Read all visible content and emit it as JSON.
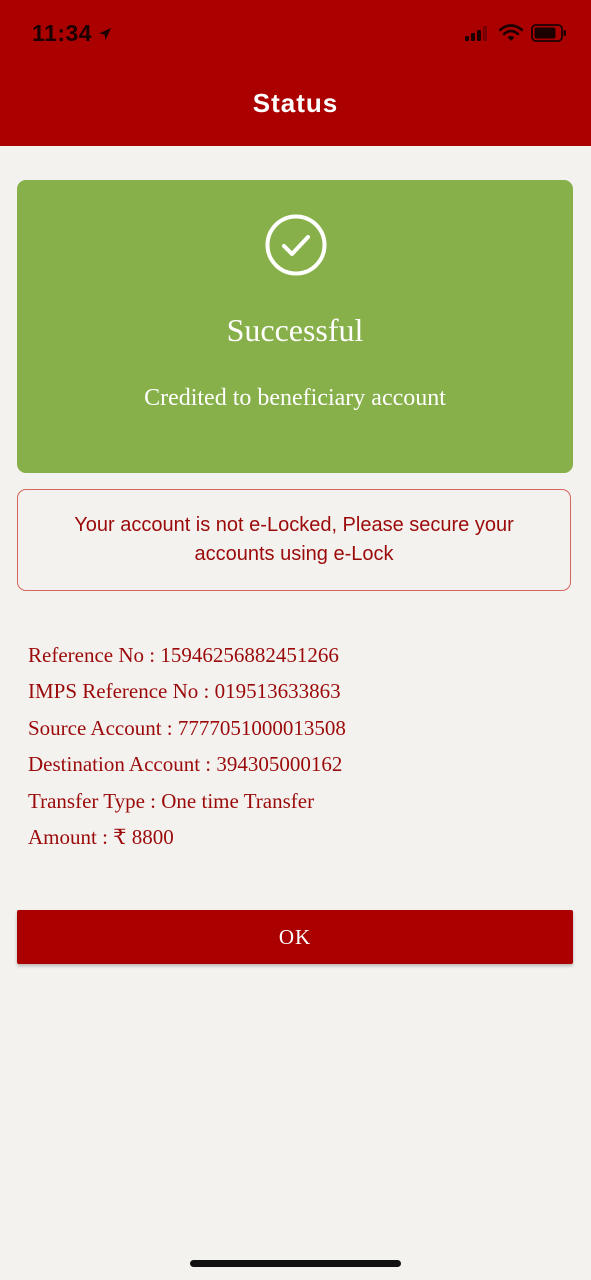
{
  "status_bar": {
    "time": "11:34"
  },
  "header": {
    "title": "Status"
  },
  "success_card": {
    "title": "Successful",
    "subtitle": "Credited to beneficiary account",
    "color": "#87b04a"
  },
  "elock_notice": {
    "text": "Your account is not e-Locked, Please secure your accounts using e-Lock"
  },
  "details": {
    "reference_no": "Reference No : 15946256882451266",
    "imps_reference_no": "IMPS Reference No : 019513633863",
    "source_account": "Source Account : 7777051000013508",
    "destination_account": "Destination Account : 394305000162",
    "transfer_type": "Transfer Type : One time Transfer",
    "amount": "Amount : ₹ 8800"
  },
  "actions": {
    "ok_label": "OK"
  },
  "theme": {
    "primary": "#ab0000",
    "text_accent": "#9b0a0a",
    "background": "#f4f2ef"
  }
}
